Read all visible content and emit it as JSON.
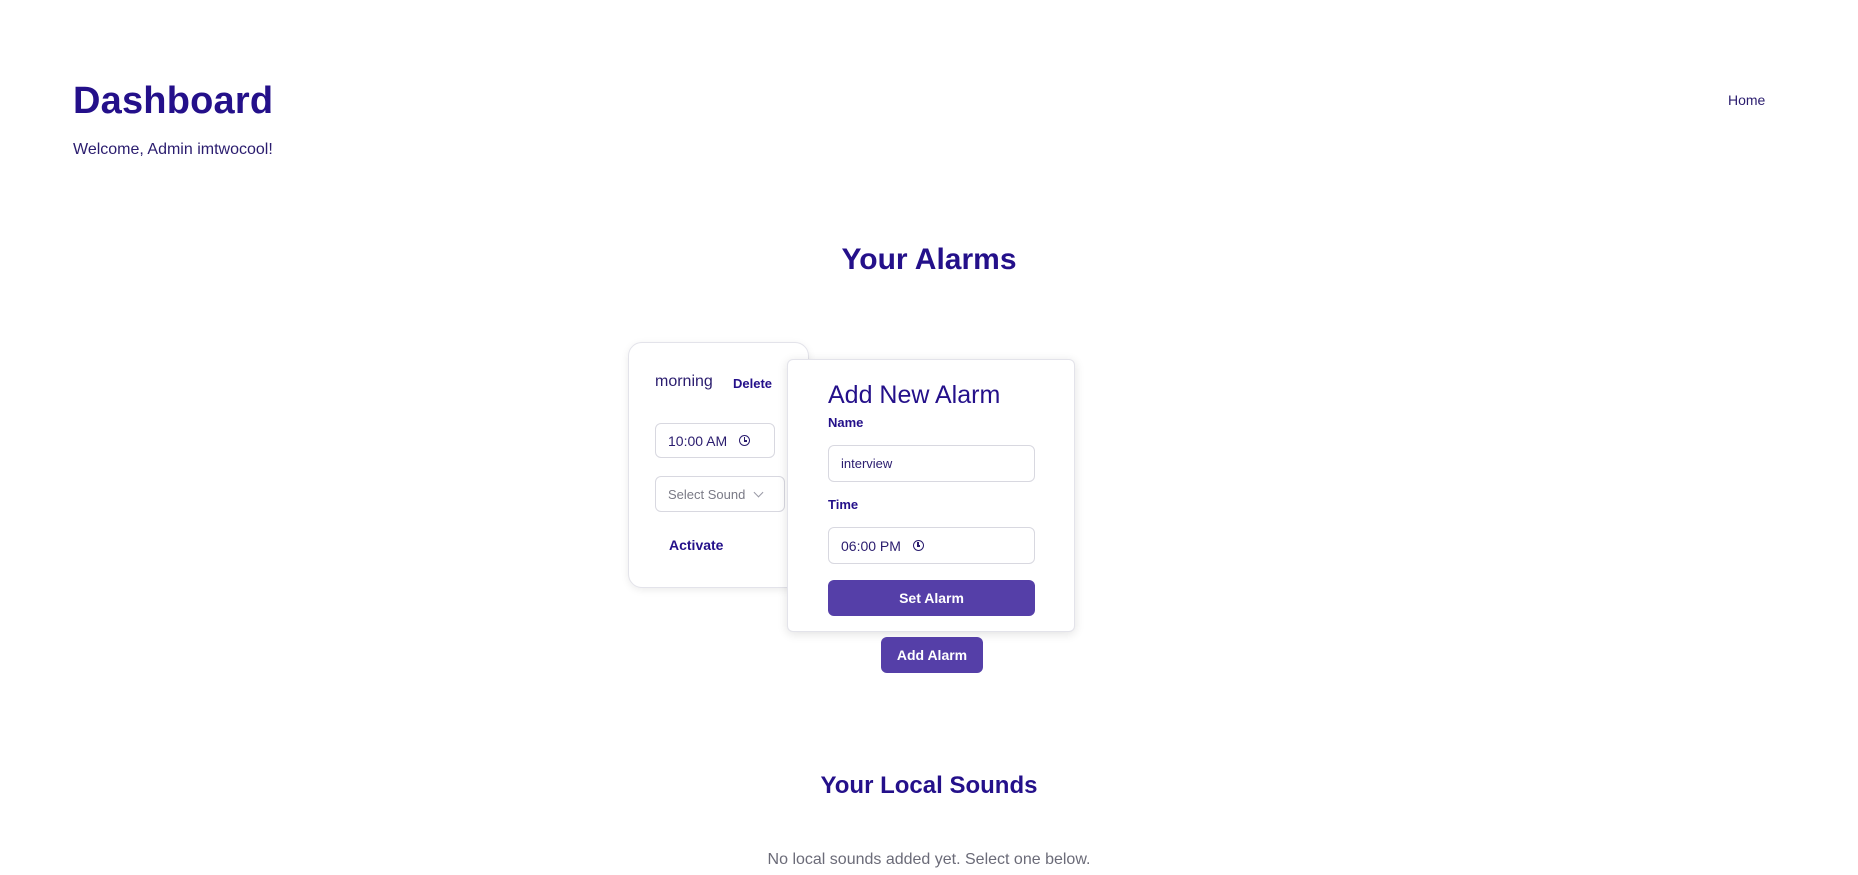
{
  "header": {
    "title": "Dashboard",
    "welcome": "Welcome, Admin imtwocool!",
    "nav_home": "Home"
  },
  "alarms_section": {
    "title": "Your Alarms",
    "alarms": [
      {
        "name": "morning",
        "delete_label": "Delete",
        "time": "10:00 AM",
        "sound_placeholder": "Select Sound",
        "activate_label": "Activate"
      }
    ],
    "add_form": {
      "title": "Add New Alarm",
      "name_label": "Name",
      "name_value": "interview",
      "time_label": "Time",
      "time_value": "06:00 PM",
      "submit_label": "Set Alarm"
    },
    "add_button_label": "Add Alarm"
  },
  "sounds_section": {
    "title": "Your Local Sounds",
    "empty_message": "No local sounds added yet. Select one below."
  },
  "colors": {
    "primary": "#553fa8",
    "heading": "#24108a"
  }
}
